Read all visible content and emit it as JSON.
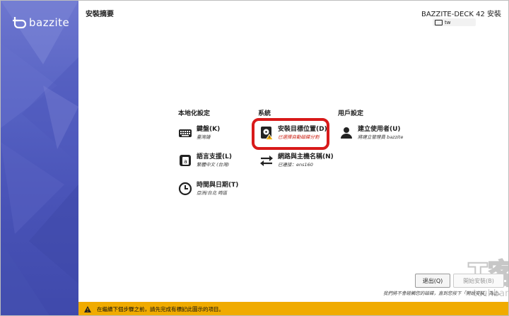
{
  "brand": {
    "name": "bazzite"
  },
  "header": {
    "page_title": "安裝摘要",
    "product_title": "BAZZITE-DECK 42 安裝",
    "keyboard_layout": "tw"
  },
  "columns": [
    {
      "title": "本地化設定"
    },
    {
      "title": "系統"
    },
    {
      "title": "用戶設定"
    }
  ],
  "spokes": {
    "keyboard": {
      "title": "鍵盤(K)",
      "status": "臺灣語",
      "icon": "keyboard-icon"
    },
    "language": {
      "title": "語言支援(L)",
      "status": "繁體中文 (台灣)",
      "icon": "language-icon"
    },
    "time": {
      "title": "時間與日期(T)",
      "status": "亞洲/台北 時區",
      "icon": "clock-icon"
    },
    "destination": {
      "title": "安裝目標位置(D)",
      "status": "已選擇自動磁碟分割",
      "icon": "disk-warning-icon"
    },
    "network": {
      "title": "網路與主機名稱(N)",
      "status": "已連接：ens160",
      "icon": "network-arrows-icon"
    },
    "user": {
      "title": "建立使用者(U)",
      "status": "將建立管理員 bazzite",
      "icon": "user-icon"
    }
  },
  "footer": {
    "quit_label": "退出(Q)",
    "begin_label": "開始安裝(B)",
    "hint": "我們將不會碰觸您的磁碟，直到您按下「開始安裝」為止。"
  },
  "warning_bar": {
    "text": "在繼續下個步驟之前，請先完成有標記此圖示的項目。"
  },
  "watermark": {
    "line1": "T客邦",
    "line2": "techbang.com"
  },
  "colors": {
    "sidebar": "#5561c2",
    "highlight": "#d81a1a",
    "warning": "#f0ab00",
    "status_warn": "#c9190b"
  }
}
